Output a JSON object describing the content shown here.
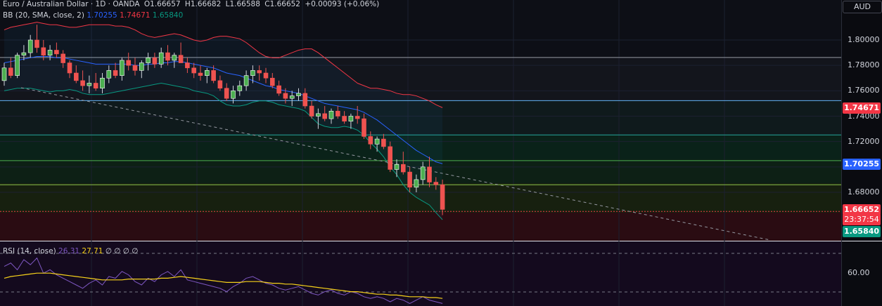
{
  "header": {
    "symbol": "Euro / Australian Dollar · 1D · OANDA",
    "open_label": "O",
    "open": "1.66657",
    "high_label": "H",
    "high": "1.66682",
    "low_label": "L",
    "low": "1.66588",
    "close_label": "C",
    "close": "1.66652",
    "change": "+0.00093 (+0.06%)"
  },
  "currency": "AUD",
  "bb_indicator": {
    "label": "BB (20, SMA, close, 2)",
    "basis": "1.70255",
    "upper": "1.74671",
    "lower": "1.65840"
  },
  "rsi_indicator": {
    "label": "RSI (14, close)",
    "rsi": "26.31",
    "ma": "27.71",
    "extras": "∅ ∅ ∅ ∅"
  },
  "price_tags": {
    "upper": "1.74671",
    "basis": "1.70255",
    "last": "1.66652",
    "countdown": "23:37:54",
    "lower": "1.65840"
  },
  "rsi_axis_label": "60.00",
  "colors": {
    "up": "#26a69a",
    "up_body": "#4caf50",
    "down": "#ef5350",
    "bb_basis": "#2962ff",
    "bb_upper": "#f23645",
    "bb_lower": "#089981",
    "rsi": "#7e57c2",
    "rsi_ma": "#f7d21a"
  },
  "chart_data": {
    "type": "candlestick",
    "y_axis": {
      "min": 1.648,
      "max": 1.815,
      "ticks": [
        "1.80000",
        "1.78000",
        "1.76000",
        "1.74000",
        "1.72000",
        "1.70000",
        "1.68000"
      ],
      "tick_values": [
        1.8,
        1.78,
        1.76,
        1.74,
        1.72,
        1.7,
        1.68
      ]
    },
    "fib_levels": [
      1.7865,
      1.7525,
      1.7255,
      1.7052,
      1.6862,
      1.6652
    ],
    "candles": [
      [
        1.768,
        1.782,
        1.764,
        1.778
      ],
      [
        1.778,
        1.786,
        1.77,
        1.772
      ],
      [
        1.772,
        1.79,
        1.77,
        1.788
      ],
      [
        1.788,
        1.796,
        1.784,
        1.79
      ],
      [
        1.79,
        1.804,
        1.786,
        1.8
      ],
      [
        1.8,
        1.812,
        1.79,
        1.794
      ],
      [
        1.794,
        1.8,
        1.784,
        1.788
      ],
      [
        1.788,
        1.796,
        1.784,
        1.792
      ],
      [
        1.792,
        1.798,
        1.786,
        1.789
      ],
      [
        1.789,
        1.792,
        1.778,
        1.782
      ],
      [
        1.782,
        1.784,
        1.77,
        1.774
      ],
      [
        1.774,
        1.78,
        1.766,
        1.768
      ],
      [
        1.768,
        1.776,
        1.76,
        1.764
      ],
      [
        1.764,
        1.772,
        1.758,
        1.766
      ],
      [
        1.766,
        1.774,
        1.76,
        1.762
      ],
      [
        1.762,
        1.774,
        1.758,
        1.77
      ],
      [
        1.77,
        1.78,
        1.766,
        1.776
      ],
      [
        1.776,
        1.782,
        1.77,
        1.772
      ],
      [
        1.772,
        1.786,
        1.768,
        1.784
      ],
      [
        1.784,
        1.79,
        1.776,
        1.78
      ],
      [
        1.78,
        1.786,
        1.772,
        1.776
      ],
      [
        1.776,
        1.784,
        1.77,
        1.782
      ],
      [
        1.782,
        1.79,
        1.776,
        1.786
      ],
      [
        1.786,
        1.79,
        1.778,
        1.781
      ],
      [
        1.781,
        1.794,
        1.778,
        1.79
      ],
      [
        1.79,
        1.796,
        1.78,
        1.784
      ],
      [
        1.784,
        1.79,
        1.778,
        1.788
      ],
      [
        1.788,
        1.798,
        1.782,
        1.782
      ],
      [
        1.782,
        1.786,
        1.774,
        1.778
      ],
      [
        1.778,
        1.782,
        1.77,
        1.774
      ],
      [
        1.774,
        1.78,
        1.768,
        1.772
      ],
      [
        1.772,
        1.778,
        1.766,
        1.776
      ],
      [
        1.776,
        1.78,
        1.766,
        1.768
      ],
      [
        1.768,
        1.772,
        1.76,
        1.762
      ],
      [
        1.762,
        1.766,
        1.752,
        1.754
      ],
      [
        1.754,
        1.764,
        1.75,
        1.76
      ],
      [
        1.76,
        1.768,
        1.756,
        1.764
      ],
      [
        1.764,
        1.776,
        1.76,
        1.772
      ],
      [
        1.772,
        1.78,
        1.766,
        1.776
      ],
      [
        1.776,
        1.78,
        1.768,
        1.774
      ],
      [
        1.774,
        1.778,
        1.766,
        1.77
      ],
      [
        1.77,
        1.774,
        1.762,
        1.764
      ],
      [
        1.764,
        1.768,
        1.756,
        1.758
      ],
      [
        1.758,
        1.762,
        1.75,
        1.754
      ],
      [
        1.754,
        1.76,
        1.748,
        1.756
      ],
      [
        1.756,
        1.762,
        1.752,
        1.758
      ],
      [
        1.758,
        1.762,
        1.746,
        1.748
      ],
      [
        1.748,
        1.752,
        1.738,
        1.74
      ],
      [
        1.74,
        1.746,
        1.73,
        1.742
      ],
      [
        1.742,
        1.748,
        1.736,
        1.738
      ],
      [
        1.738,
        1.746,
        1.734,
        1.744
      ],
      [
        1.744,
        1.748,
        1.738,
        1.74
      ],
      [
        1.74,
        1.744,
        1.734,
        1.736
      ],
      [
        1.736,
        1.742,
        1.73,
        1.74
      ],
      [
        1.74,
        1.748,
        1.734,
        1.738
      ],
      [
        1.738,
        1.742,
        1.722,
        1.724
      ],
      [
        1.724,
        1.728,
        1.714,
        1.718
      ],
      [
        1.718,
        1.724,
        1.712,
        1.722
      ],
      [
        1.722,
        1.726,
        1.714,
        1.716
      ],
      [
        1.716,
        1.72,
        1.696,
        1.698
      ],
      [
        1.698,
        1.706,
        1.692,
        1.702
      ],
      [
        1.702,
        1.712,
        1.694,
        1.696
      ],
      [
        1.696,
        1.7,
        1.68,
        1.684
      ],
      [
        1.684,
        1.694,
        1.68,
        1.69
      ],
      [
        1.69,
        1.704,
        1.686,
        1.7
      ],
      [
        1.7,
        1.708,
        1.684,
        1.688
      ],
      [
        1.688,
        1.692,
        1.682,
        1.686
      ],
      [
        1.686,
        1.69,
        1.662,
        1.6665
      ]
    ],
    "bb_upper": [
      1.808,
      1.81,
      1.811,
      1.812,
      1.813,
      1.814,
      1.813,
      1.812,
      1.812,
      1.811,
      1.81,
      1.81,
      1.811,
      1.812,
      1.812,
      1.812,
      1.812,
      1.811,
      1.811,
      1.81,
      1.808,
      1.805,
      1.803,
      1.802,
      1.803,
      1.804,
      1.805,
      1.804,
      1.802,
      1.8,
      1.799,
      1.8,
      1.802,
      1.803,
      1.803,
      1.802,
      1.801,
      1.798,
      1.794,
      1.79,
      1.787,
      1.786,
      1.786,
      1.788,
      1.79,
      1.792,
      1.793,
      1.793,
      1.79,
      1.786,
      1.782,
      1.778,
      1.774,
      1.77,
      1.766,
      1.764,
      1.762,
      1.762,
      1.761,
      1.76,
      1.758,
      1.757,
      1.757,
      1.756,
      1.754,
      1.752,
      1.749,
      1.7467
    ],
    "bb_basis": [
      1.782,
      1.783,
      1.784,
      1.785,
      1.786,
      1.787,
      1.787,
      1.787,
      1.786,
      1.786,
      1.785,
      1.784,
      1.783,
      1.782,
      1.781,
      1.781,
      1.781,
      1.781,
      1.781,
      1.781,
      1.78,
      1.78,
      1.781,
      1.781,
      1.782,
      1.782,
      1.783,
      1.783,
      1.782,
      1.781,
      1.78,
      1.779,
      1.778,
      1.776,
      1.774,
      1.773,
      1.772,
      1.77,
      1.768,
      1.766,
      1.764,
      1.763,
      1.761,
      1.76,
      1.759,
      1.758,
      1.756,
      1.754,
      1.752,
      1.75,
      1.749,
      1.748,
      1.747,
      1.746,
      1.745,
      1.743,
      1.74,
      1.737,
      1.733,
      1.729,
      1.725,
      1.721,
      1.717,
      1.713,
      1.71,
      1.707,
      1.704,
      1.70255
    ],
    "bb_lower": [
      1.76,
      1.761,
      1.762,
      1.762,
      1.762,
      1.761,
      1.76,
      1.759,
      1.76,
      1.76,
      1.761,
      1.76,
      1.758,
      1.757,
      1.757,
      1.757,
      1.758,
      1.759,
      1.76,
      1.761,
      1.762,
      1.763,
      1.764,
      1.765,
      1.766,
      1.765,
      1.764,
      1.763,
      1.762,
      1.76,
      1.759,
      1.758,
      1.756,
      1.752,
      1.749,
      1.748,
      1.748,
      1.749,
      1.751,
      1.752,
      1.752,
      1.751,
      1.749,
      1.748,
      1.747,
      1.746,
      1.744,
      1.739,
      1.734,
      1.732,
      1.731,
      1.731,
      1.732,
      1.731,
      1.729,
      1.725,
      1.719,
      1.714,
      1.708,
      1.7,
      1.694,
      1.686,
      1.68,
      1.676,
      1.673,
      1.67,
      1.664,
      1.6584
    ],
    "rsi": [
      62,
      66,
      58,
      70,
      64,
      72,
      54,
      58,
      52,
      48,
      44,
      40,
      36,
      42,
      46,
      40,
      50,
      48,
      56,
      52,
      44,
      40,
      48,
      44,
      52,
      56,
      50,
      58,
      46,
      44,
      42,
      40,
      38,
      36,
      32,
      38,
      42,
      48,
      50,
      46,
      42,
      40,
      36,
      34,
      36,
      38,
      34,
      30,
      28,
      32,
      34,
      30,
      28,
      32,
      30,
      26,
      24,
      26,
      24,
      20,
      24,
      22,
      18,
      22,
      26,
      22,
      20,
      18
    ],
    "rsi_ma": [
      48,
      50,
      51,
      52,
      53,
      54,
      54,
      54,
      53,
      52,
      51,
      50,
      49,
      48,
      47,
      46,
      46,
      46,
      46,
      47,
      47,
      47,
      47,
      47,
      48,
      48,
      49,
      50,
      49,
      48,
      47,
      46,
      45,
      44,
      43,
      43,
      43,
      44,
      44,
      44,
      43,
      42,
      42,
      41,
      41,
      40,
      39,
      38,
      37,
      36,
      35,
      34,
      33,
      32,
      32,
      31,
      30,
      29,
      29,
      28,
      28,
      27,
      26,
      26,
      26,
      25,
      25,
      24
    ]
  }
}
